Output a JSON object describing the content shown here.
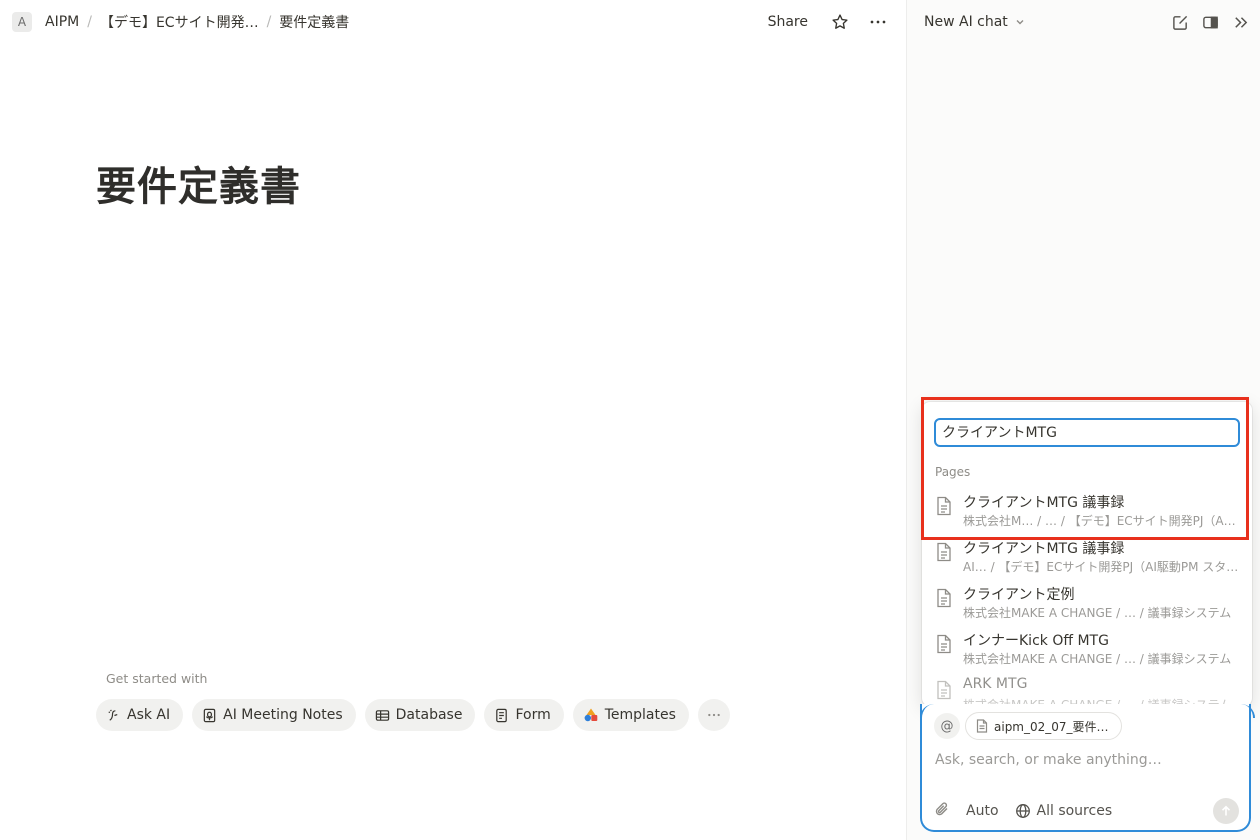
{
  "topbar": {
    "workspace_initial": "A",
    "breadcrumbs": [
      "AIPM",
      "【デモ】ECサイト開発…",
      "要件定義書"
    ],
    "separator": "/",
    "share_label": "Share"
  },
  "page": {
    "title": "要件定義書",
    "get_started_label": "Get started with",
    "chips": [
      {
        "label": "Ask AI",
        "icon": "ai-icon"
      },
      {
        "label": "AI Meeting Notes",
        "icon": "meeting-notes-icon"
      },
      {
        "label": "Database",
        "icon": "table-icon"
      },
      {
        "label": "Form",
        "icon": "form-icon"
      },
      {
        "label": "Templates",
        "icon": "templates-icon"
      }
    ]
  },
  "panel": {
    "chat_title": "New AI chat"
  },
  "mention_menu": {
    "query": "クライアントMTG",
    "group_label": "Pages",
    "results": [
      {
        "title": "クライアントMTG 議事録",
        "path": "株式会社M…   / … / 【デモ】ECサイト開発PJ（A…"
      },
      {
        "title": "クライアントMTG 議事録",
        "path": "AI… / 【デモ】ECサイト開発PJ（AI駆動PM スタ…"
      },
      {
        "title": "クライアント定例",
        "path": "株式会社MAKE A CHANGE / … / 議事録システム"
      },
      {
        "title": "インナーKick Off MTG",
        "path": "株式会社MAKE A CHANGE / … / 議事録システム"
      },
      {
        "title": "ARK MTG",
        "path": "株式会社MAKE A CHANGE / … / 議事録システム"
      }
    ]
  },
  "composer": {
    "at_symbol": "@",
    "attachment_name": "aipm_02_07_要件…",
    "placeholder": "Ask, search, or make anything…",
    "mode_label": "Auto",
    "sources_label": "All sources"
  },
  "colors": {
    "accent_blue": "#2f8bd8",
    "highlight_red": "#e8301c"
  }
}
